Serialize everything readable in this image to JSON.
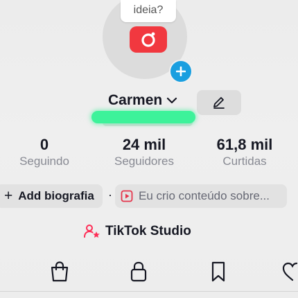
{
  "profile": {
    "idea_bubble": "ideia?",
    "name": "Carmen"
  },
  "stats": {
    "following": {
      "value": "0",
      "label": "Seguindo"
    },
    "followers": {
      "value": "24 mil",
      "label": "Seguidores"
    },
    "likes": {
      "value": "61,8 mil",
      "label": "Curtidas"
    }
  },
  "bio": {
    "add_plus": "+",
    "add_label": "Add biografia",
    "separator": "·",
    "prompt": "Eu crio conteúdo sobre..."
  },
  "studio": {
    "label": "TikTok Studio"
  },
  "tabs": [
    {
      "icon": "shopping-bag-icon"
    },
    {
      "icon": "lock-icon"
    },
    {
      "icon": "bookmark-icon"
    },
    {
      "icon": "heart-icon"
    }
  ],
  "colors": {
    "camera_red": "#f1383f",
    "add_blue": "#1a9fe0",
    "username_highlight": "#3df29a",
    "studio_pink": "#fe2c55",
    "text_dark": "#161823",
    "text_gray": "#888a93"
  }
}
